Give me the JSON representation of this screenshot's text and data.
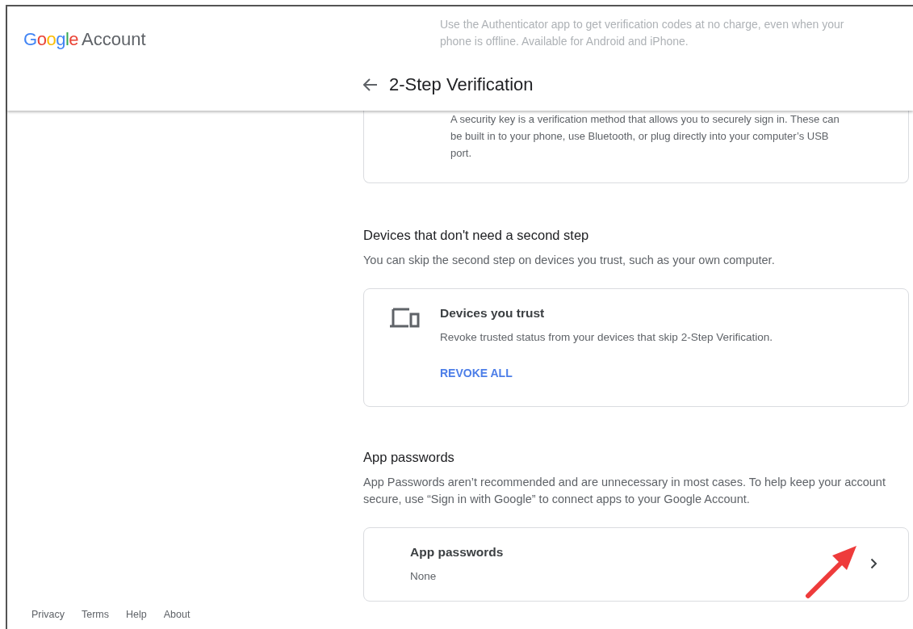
{
  "header": {
    "logo": "Google",
    "product": "Account",
    "faded_text": "Use the Authenticator app to get verification codes at no charge, even when your phone is offline. Available for Android and iPhone.",
    "page_title": "2-Step Verification"
  },
  "security_key_card": {
    "description": "A security key is a verification method that allows you to securely sign in. These can be built in to your phone, use Bluetooth, or plug directly into your computer’s USB port."
  },
  "trusted_devices": {
    "heading": "Devices that don't need a second step",
    "description": "You can skip the second step on devices you trust, such as your own computer.",
    "card": {
      "title": "Devices you trust",
      "description": "Revoke trusted status from your devices that skip 2-Step Verification.",
      "action": "REVOKE ALL"
    }
  },
  "app_passwords": {
    "heading": "App passwords",
    "description": "App Passwords aren’t recommended and are unnecessary in most cases. To help keep your account secure, use “Sign in with Google” to connect apps to your Google Account.",
    "card": {
      "title": "App passwords",
      "value": "None"
    }
  },
  "footer": [
    "Privacy",
    "Terms",
    "Help",
    "About"
  ]
}
